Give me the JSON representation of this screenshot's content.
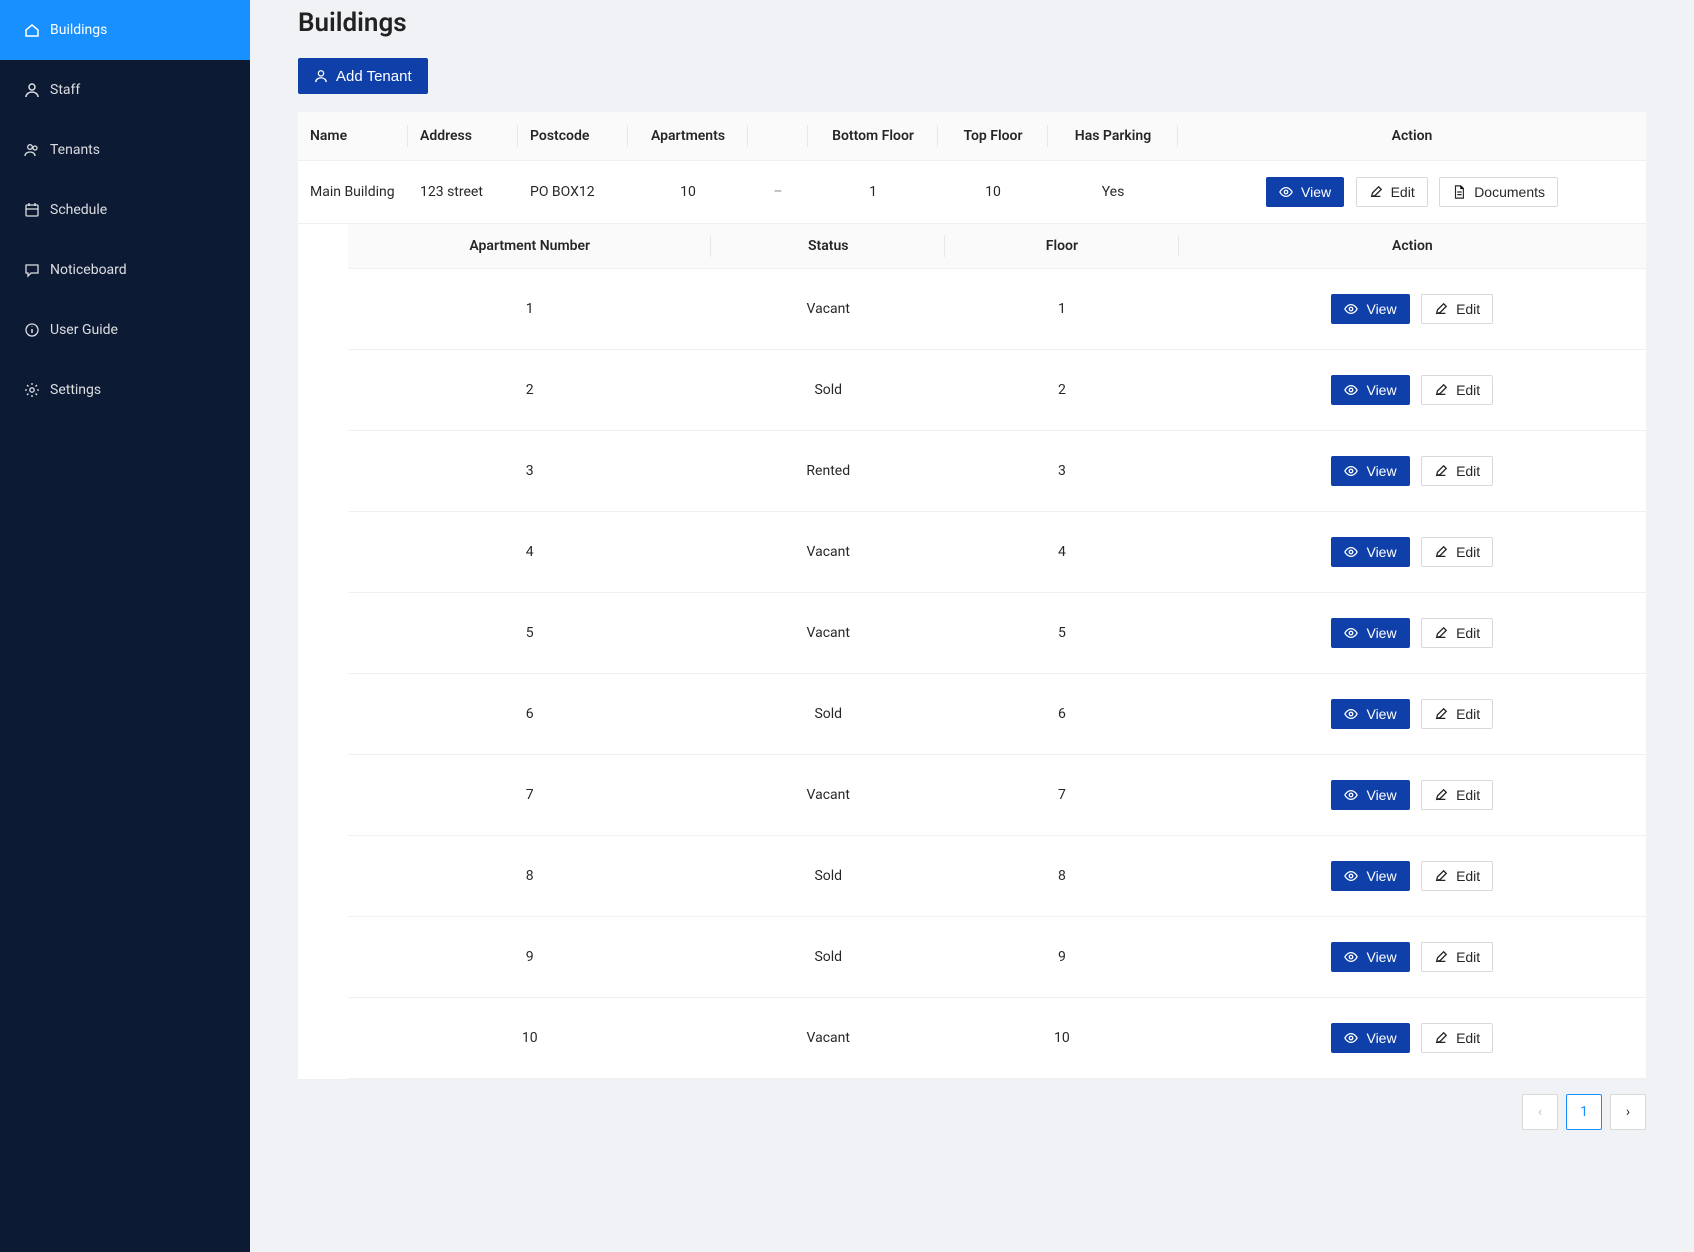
{
  "sidebar": {
    "items": [
      {
        "label": "Buildings",
        "icon": "home"
      },
      {
        "label": "Staff",
        "icon": "user"
      },
      {
        "label": "Tenants",
        "icon": "tenants"
      },
      {
        "label": "Schedule",
        "icon": "calendar"
      },
      {
        "label": "Noticeboard",
        "icon": "chat"
      },
      {
        "label": "User Guide",
        "icon": "info"
      },
      {
        "label": "Settings",
        "icon": "gear"
      }
    ]
  },
  "page": {
    "title": "Buildings",
    "add_tenant_label": "Add Tenant"
  },
  "outer_columns": {
    "name": "Name",
    "address": "Address",
    "postcode": "Postcode",
    "apartments": "Apartments",
    "bottom_floor": "Bottom Floor",
    "top_floor": "Top Floor",
    "has_parking": "Has Parking",
    "action": "Action"
  },
  "building": {
    "name": "Main Building",
    "address": "123 street",
    "postcode": "PO BOX12",
    "apartments": "10",
    "bottom_floor": "1",
    "top_floor": "10",
    "has_parking": "Yes"
  },
  "action_labels": {
    "view": "View",
    "edit": "Edit",
    "documents": "Documents"
  },
  "inner_columns": {
    "apartment_number": "Apartment Number",
    "status": "Status",
    "floor": "Floor",
    "action": "Action"
  },
  "apartments": [
    {
      "number": "1",
      "status": "Vacant",
      "floor": "1"
    },
    {
      "number": "2",
      "status": "Sold",
      "floor": "2"
    },
    {
      "number": "3",
      "status": "Rented",
      "floor": "3"
    },
    {
      "number": "4",
      "status": "Vacant",
      "floor": "4"
    },
    {
      "number": "5",
      "status": "Vacant",
      "floor": "5"
    },
    {
      "number": "6",
      "status": "Sold",
      "floor": "6"
    },
    {
      "number": "7",
      "status": "Vacant",
      "floor": "7"
    },
    {
      "number": "8",
      "status": "Sold",
      "floor": "8"
    },
    {
      "number": "9",
      "status": "Sold",
      "floor": "9"
    },
    {
      "number": "10",
      "status": "Vacant",
      "floor": "10"
    }
  ],
  "pagination": {
    "current": "1"
  },
  "expand_symbol": "–"
}
